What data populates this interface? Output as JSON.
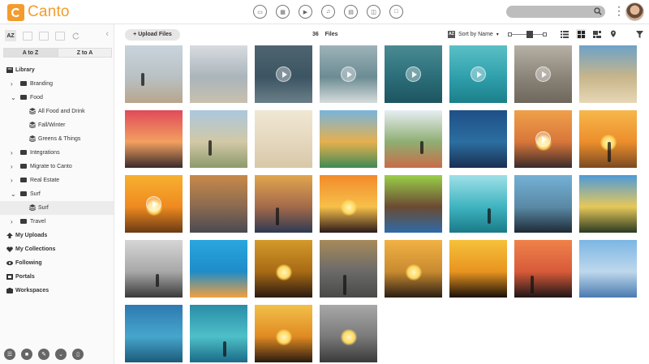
{
  "app": {
    "name": "Canto"
  },
  "colors": {
    "brand": "#f39c2d"
  },
  "top_icons": [
    "all-files-icon",
    "image-icon",
    "video-icon",
    "audio-icon",
    "document-icon",
    "presentation-icon",
    "other-file-icon"
  ],
  "sidebar": {
    "az_label": "AZ",
    "sort_a_to_z": "A to Z",
    "sort_z_to_a": "Z to A",
    "library_label": "Library",
    "tree": [
      {
        "label": "Branding",
        "type": "folder",
        "level": 1,
        "expanded": false
      },
      {
        "label": "Food",
        "type": "folder",
        "level": 1,
        "expanded": true
      },
      {
        "label": "All Food and Drink",
        "type": "album",
        "level": 2
      },
      {
        "label": "Fall/Winter",
        "type": "album",
        "level": 2
      },
      {
        "label": "Greens & Things",
        "type": "album",
        "level": 2
      },
      {
        "label": "Integrations",
        "type": "folder",
        "level": 1,
        "expanded": false
      },
      {
        "label": "Migrate to Canto",
        "type": "folder",
        "level": 1,
        "expanded": false
      },
      {
        "label": "Real Estate",
        "type": "folder",
        "level": 1,
        "expanded": false
      },
      {
        "label": "Surf",
        "type": "folder",
        "level": 1,
        "expanded": true
      },
      {
        "label": "Surf",
        "type": "album",
        "level": 2,
        "selected": true
      },
      {
        "label": "Travel",
        "type": "folder",
        "level": 1,
        "expanded": false
      }
    ],
    "sections": [
      {
        "label": "My Uploads",
        "icon": "upload-icon"
      },
      {
        "label": "My Collections",
        "icon": "heart-icon"
      },
      {
        "label": "Following",
        "icon": "eye-icon"
      },
      {
        "label": "Portals",
        "icon": "portal-icon"
      },
      {
        "label": "Workspaces",
        "icon": "workspace-icon"
      }
    ],
    "bottom_tools": [
      "stack-icon",
      "comment-icon",
      "edit-icon",
      "chevron-down-icon",
      "trash-icon"
    ]
  },
  "toolbar": {
    "upload_label": "Upload Files",
    "count_value": "36",
    "count_label": "Files",
    "sort_label": "Sort by Name"
  },
  "grid": {
    "tiles": [
      {
        "video": false,
        "sky": "#c8d4dc",
        "mid": "#b9c1c4",
        "ground": "#b8a58c",
        "sun": false
      },
      {
        "video": false,
        "sky": "#d8dce0",
        "mid": "#aab5bb",
        "ground": "#c9bfae",
        "sun": false
      },
      {
        "video": true,
        "sky": "#4f6470",
        "mid": "#3c5563",
        "ground": "#6a7f88",
        "sun": false
      },
      {
        "video": true,
        "sky": "#9db2b9",
        "mid": "#6c8c93",
        "ground": "#d6dcdc",
        "sun": false
      },
      {
        "video": true,
        "sky": "#4a8b93",
        "mid": "#2b6e79",
        "ground": "#1d5560",
        "sun": false
      },
      {
        "video": true,
        "sky": "#5bbfc6",
        "mid": "#2fa0ac",
        "ground": "#1b7f8a",
        "sun": false
      },
      {
        "video": true,
        "sky": "#b7b1a5",
        "mid": "#8b8478",
        "ground": "#6f675c",
        "sun": false
      },
      {
        "video": false,
        "sky": "#6da2c8",
        "mid": "#c8b58a",
        "ground": "#e6d7b6",
        "sun": false
      },
      {
        "video": false,
        "sky": "#e04a5a",
        "mid": "#f2a060",
        "ground": "#3a2a2a",
        "sun": false
      },
      {
        "video": false,
        "sky": "#aac8dc",
        "mid": "#d2c8a6",
        "ground": "#8c9a6a",
        "sun": false
      },
      {
        "video": false,
        "sky": "#f0e7d4",
        "mid": "#e4d7bd",
        "ground": "#d8c8a8",
        "sun": false
      },
      {
        "video": false,
        "sky": "#78b4dc",
        "mid": "#e6b04e",
        "ground": "#3f8a56",
        "sun": false
      },
      {
        "video": false,
        "sky": "#e6eef2",
        "mid": "#8fae72",
        "ground": "#c96c4a",
        "sun": false
      },
      {
        "video": false,
        "sky": "#1f4f86",
        "mid": "#2b6ea0",
        "ground": "#1a2f52",
        "sun": false
      },
      {
        "video": true,
        "sky": "#f0a04a",
        "mid": "#d8763a",
        "ground": "#3a2a2a",
        "sun": true
      },
      {
        "video": false,
        "sky": "#f7b84a",
        "mid": "#ec8e2c",
        "ground": "#7a4a22",
        "sun": true
      },
      {
        "video": true,
        "sky": "#f7b030",
        "mid": "#ef8a20",
        "ground": "#6a3a14",
        "sun": true
      },
      {
        "video": false,
        "sky": "#c88a48",
        "mid": "#8a6a50",
        "ground": "#4a4a52",
        "sun": false
      },
      {
        "video": false,
        "sky": "#e2a64e",
        "mid": "#a46a4a",
        "ground": "#2e3a52",
        "sun": false
      },
      {
        "video": false,
        "sky": "#f28a2a",
        "mid": "#f7c04a",
        "ground": "#2a1a1a",
        "sun": true
      },
      {
        "video": false,
        "sky": "#9ad04a",
        "mid": "#6b4a32",
        "ground": "#2f6aa8",
        "sun": false
      },
      {
        "video": false,
        "sky": "#9ee0e8",
        "mid": "#3fb4c0",
        "ground": "#1a7a88",
        "sun": false
      },
      {
        "video": false,
        "sky": "#74b0d6",
        "mid": "#5a8aa6",
        "ground": "#1e2a36",
        "sun": false
      },
      {
        "video": false,
        "sky": "#4e9ad8",
        "mid": "#e6c85a",
        "ground": "#2a3a22",
        "sun": false
      },
      {
        "video": false,
        "sky": "#d6d6d6",
        "mid": "#a8a8a8",
        "ground": "#3a3a3a",
        "sun": false
      },
      {
        "video": false,
        "sky": "#2aa6e0",
        "mid": "#1e8cc8",
        "ground": "#f2a040",
        "sun": false
      },
      {
        "video": false,
        "sky": "#d49a2a",
        "mid": "#a86a14",
        "ground": "#2a1a10",
        "sun": true
      },
      {
        "video": false,
        "sky": "#a88a5a",
        "mid": "#6a6a6a",
        "ground": "#4a4a48",
        "sun": false
      },
      {
        "video": false,
        "sky": "#f2b244",
        "mid": "#c88a30",
        "ground": "#2a1e14",
        "sun": true
      },
      {
        "video": false,
        "sky": "#f6c13a",
        "mid": "#e89420",
        "ground": "#1a1008",
        "sun": false
      },
      {
        "video": false,
        "sky": "#f0824a",
        "mid": "#d85a3a",
        "ground": "#1e1616",
        "sun": false
      },
      {
        "video": false,
        "sky": "#7cb6e4",
        "mid": "#bed8ec",
        "ground": "#4a7ab0",
        "sun": false
      },
      {
        "video": false,
        "sky": "#2d7ab0",
        "mid": "#46a6cc",
        "ground": "#1c5a7a",
        "sun": false
      },
      {
        "video": false,
        "sky": "#2a8ca8",
        "mid": "#4ec0c8",
        "ground": "#1a6a88",
        "sun": false
      },
      {
        "video": false,
        "sky": "#f2c04a",
        "mid": "#e08a22",
        "ground": "#2a1a10",
        "sun": true
      },
      {
        "video": false,
        "sky": "#a8a8a8",
        "mid": "#7a7a7a",
        "ground": "#3a3a3a",
        "sun": true
      }
    ]
  }
}
